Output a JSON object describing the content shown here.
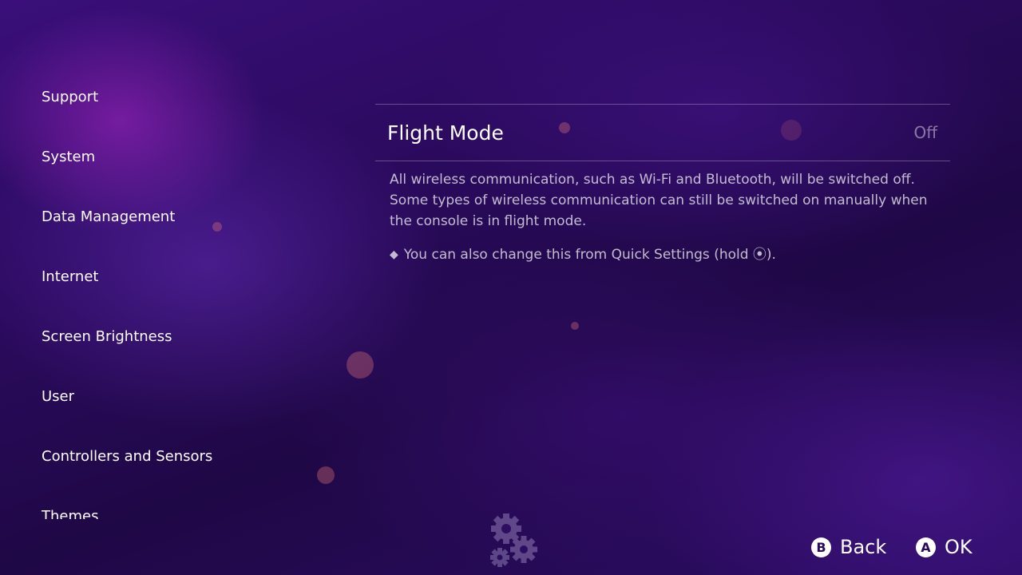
{
  "sidebar": {
    "items": [
      {
        "label": "Support"
      },
      {
        "label": "System"
      },
      {
        "label": "Data Management"
      },
      {
        "label": "Internet"
      },
      {
        "label": "Screen Brightness"
      },
      {
        "label": "User"
      },
      {
        "label": "Controllers and Sensors"
      },
      {
        "label": "Themes"
      }
    ]
  },
  "setting": {
    "title": "Flight Mode",
    "value": "Off",
    "description": "All wireless communication, such as Wi-Fi and Bluetooth, will be switched off. Some types of wireless communication can still be switched on manually when the console is in flight mode.",
    "note": "You can also change this from Quick Settings (hold ⦿)."
  },
  "footer": {
    "back": {
      "glyph": "B",
      "label": "Back"
    },
    "ok": {
      "glyph": "A",
      "label": "OK"
    }
  },
  "colors": {
    "accent_text": "#ffffff",
    "background_purple": "#2a0a5c"
  },
  "icons": [
    "diamond-icon",
    "gears-icon",
    "b-button-icon",
    "a-button-icon"
  ]
}
